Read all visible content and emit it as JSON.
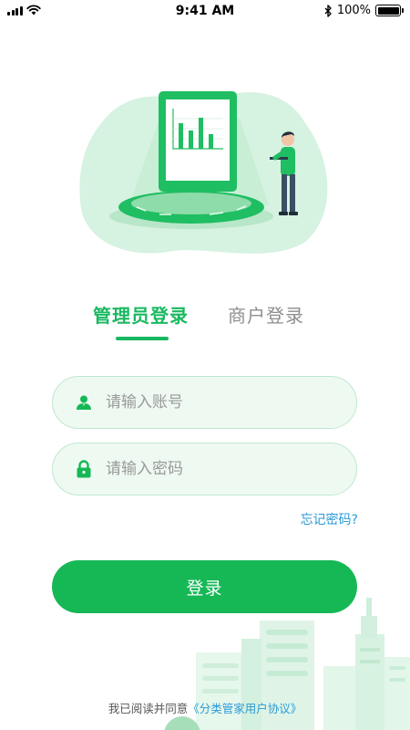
{
  "status_bar": {
    "time": "9:41 AM",
    "battery_text": "100%",
    "battery_level": 1.0,
    "icons": [
      "signal-icon",
      "wifi-icon",
      "bluetooth-icon",
      "battery-icon"
    ]
  },
  "tabs": [
    {
      "label": "管理员登录",
      "active": true
    },
    {
      "label": "商户登录",
      "active": false
    }
  ],
  "form": {
    "account_placeholder": "请输入账号",
    "account_value": "",
    "password_placeholder": "请输入密码",
    "password_value": "",
    "forgot_label": "忘记密码?",
    "login_label": "登录"
  },
  "agreement": {
    "prefix": "我已阅读并同意",
    "link": "《分类管家用户协议》"
  },
  "colors": {
    "primary": "#16b856",
    "link": "#2a9ad6",
    "field_bg": "#eef9f2",
    "inactive_tab": "#8e8e8e"
  }
}
